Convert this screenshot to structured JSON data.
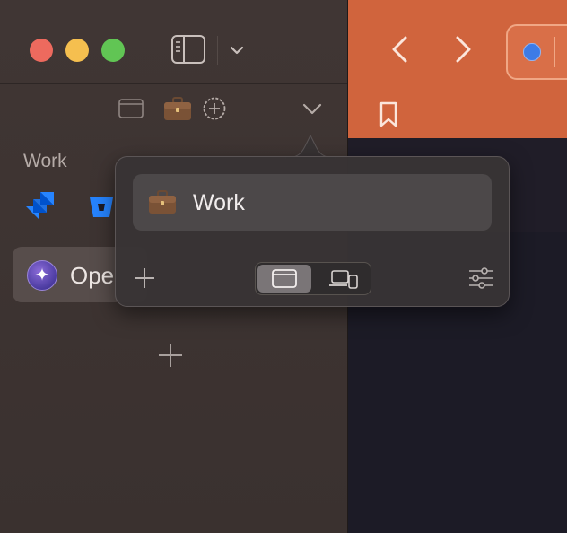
{
  "window": {
    "traffic_lights": [
      "close",
      "minimize",
      "zoom"
    ],
    "colors": {
      "close": "#ed6a5e",
      "minimize": "#f5bf4f",
      "zoom": "#61c554",
      "toolbar": "#d0643d",
      "sidebar": "#3d3432"
    }
  },
  "sidebar": {
    "space_name": "Work",
    "favorites": [
      "jira-icon",
      "bitbucket-icon"
    ],
    "pinned_tab": {
      "icon": "sparkle-icon",
      "label": "Ope"
    },
    "icons": [
      "sidebar-toggle-icon",
      "chevron-down-icon",
      "window-icon",
      "briefcase-icon",
      "plus-circle-icon",
      "chevron-down-icon",
      "plus-icon"
    ]
  },
  "toolbar": {
    "icons": [
      "back-icon",
      "forward-icon",
      "site-favicon",
      "bookmark-icon"
    ]
  },
  "popover": {
    "space": {
      "icon": "briefcase-icon",
      "label": "Work"
    },
    "segments": [
      "window-icon",
      "devices-icon"
    ],
    "selected_segment": "window-icon",
    "icons": [
      "plus-icon",
      "sliders-icon"
    ]
  }
}
